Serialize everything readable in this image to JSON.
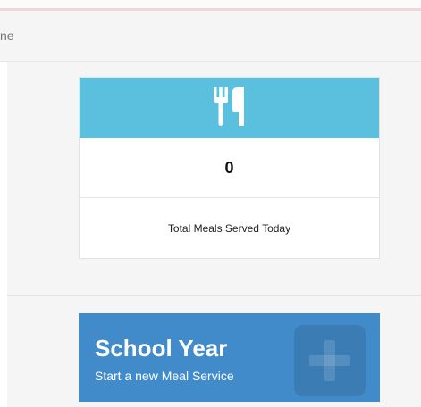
{
  "header": {
    "text": "ne"
  },
  "meals_card": {
    "icon": "utensils-icon",
    "value": "0",
    "label": "Total Meals Served Today",
    "banner_color": "#5bc0de"
  },
  "school_year_card": {
    "title": "School Year",
    "subtitle": "Start a new Meal Service",
    "icon": "plus-icon",
    "color": "#428bca"
  }
}
